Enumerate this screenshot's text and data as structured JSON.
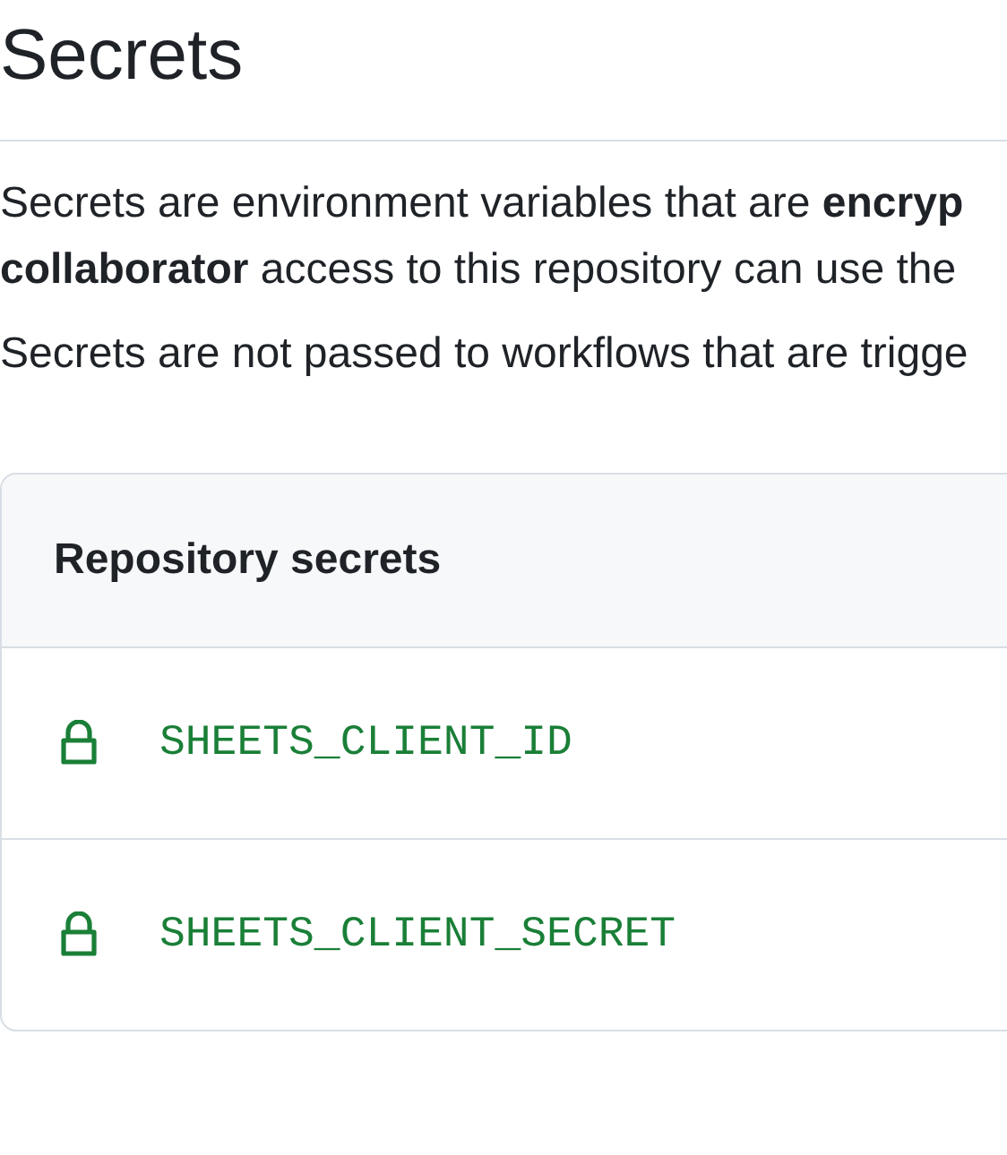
{
  "title": "Secrets",
  "description": [
    "Secrets are environment variables that are **encryp**",
    "**collaborator** access to this repository can use the"
  ],
  "note": "Secrets are not passed to workflows that are trigge",
  "repository_secrets": {
    "heading": "Repository secrets",
    "items": [
      {
        "name": "SHEETS_CLIENT_ID"
      },
      {
        "name": "SHEETS_CLIENT_SECRET"
      }
    ]
  }
}
